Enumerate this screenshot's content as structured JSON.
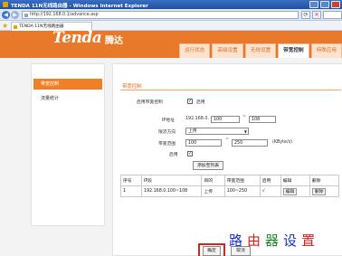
{
  "window": {
    "title": "TENDA 11N无线路由器 - Windows Internet Explorer"
  },
  "address": {
    "url": "http://192.168.0.1/advance.asp"
  },
  "tab": {
    "label": "TENDA 11N无线路由器"
  },
  "header": {
    "logo_text": "Tenda",
    "logo_cn": "腾达",
    "nav": [
      "运行状态",
      "高级设置",
      "无线设置",
      "带宽控制",
      "特殊应用"
    ]
  },
  "sidebar": {
    "items": [
      "带宽控制",
      "流量统计"
    ]
  },
  "form": {
    "section_title": "带宽控制",
    "enable_label": "启用带宽控制",
    "enable_text": "启用",
    "enable_checked": true,
    "ip_label": "IP地址",
    "ip_prefix": "192.168.0.",
    "ip_start": "100",
    "ip_sep": "~",
    "ip_end": "108",
    "direction_label": "限流方向",
    "direction_value": "上传",
    "bandwidth_label": "带宽范围",
    "bw_min": "100",
    "bw_sep": "~",
    "bw_max": "250",
    "bw_unit": "(KByte/s)",
    "enable2_label": "启用",
    "enable2_checked": true,
    "add_button": "添加至列表"
  },
  "table": {
    "headers": [
      "序号",
      "IP段",
      "目的",
      "带宽范围",
      "启用",
      "编辑",
      "删除"
    ],
    "rows": [
      [
        "1",
        "192.168.0.100~108",
        "上传",
        "100~250",
        "√",
        "编辑",
        "删除"
      ]
    ]
  },
  "actions": {
    "ok": "确定",
    "cancel": "取消"
  },
  "watermark": {
    "chars": [
      "路",
      "由",
      "器",
      "设",
      "置"
    ],
    "colors": [
      "#1a2fc8",
      "#d41f1f",
      "#1a8a2a",
      "#1a2fc8",
      "#d41f1f"
    ]
  }
}
